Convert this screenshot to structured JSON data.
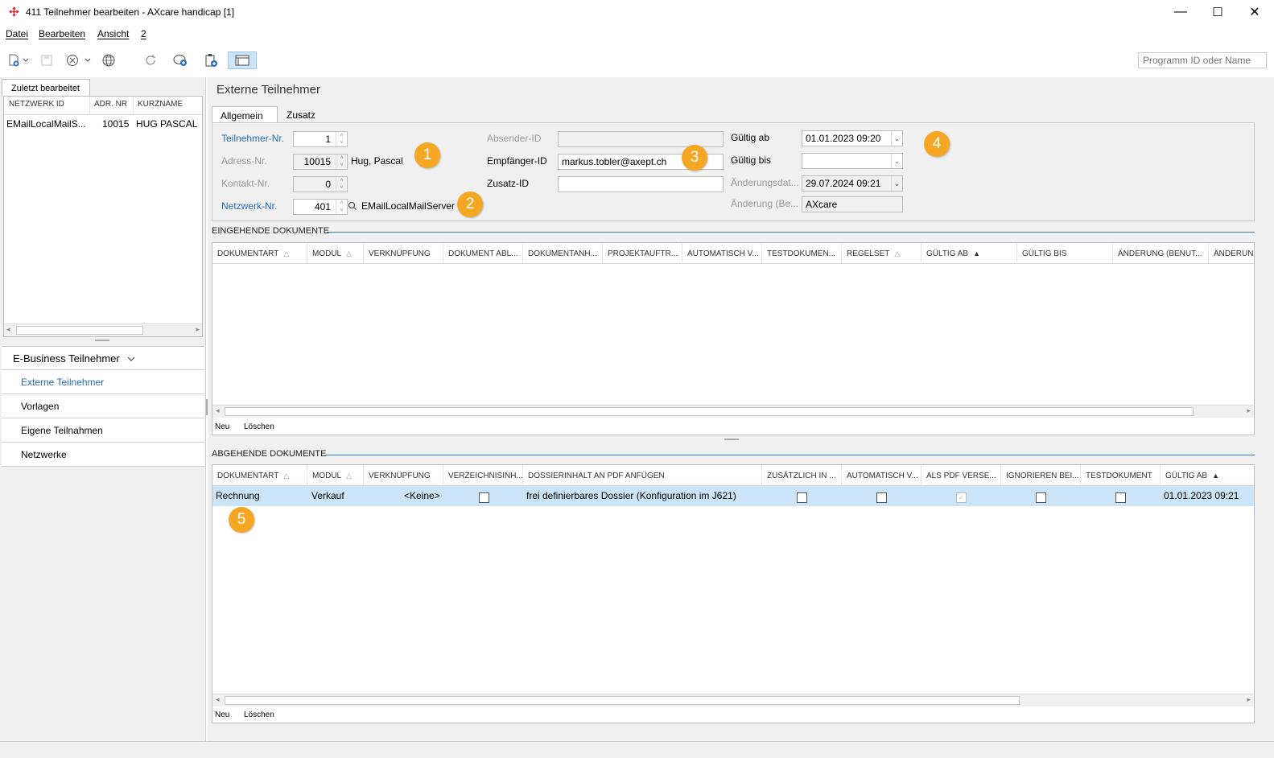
{
  "window": {
    "title": "411 Teilnehmer bearbeiten - AXcare handicap [1]",
    "minimize": "—",
    "maximize": "☐",
    "close": "✕"
  },
  "menu": [
    "Datei",
    "Bearbeiten",
    "Ansicht",
    "2"
  ],
  "toolbar": {
    "search_placeholder": "Programm ID oder Name",
    "icons": [
      "new-icon",
      "save-icon",
      "cancel-icon",
      "globe-icon",
      "refresh-icon",
      "chat-icon",
      "clipboard-icon",
      "window-icon"
    ]
  },
  "recent": {
    "tab": "Zuletzt bearbeitet",
    "columns": [
      "NETZWERK ID",
      "ADR. NR",
      "KURZNAME"
    ],
    "rows": [
      {
        "netzwerk": "EMailLocalMailS...",
        "adr": "10015",
        "kurzname": "HUG PASCAL"
      }
    ]
  },
  "nav": {
    "group": "E-Business Teilnehmer",
    "items": [
      "Externe Teilnehmer",
      "Vorlagen",
      "Eigene Teilnahmen",
      "Netzwerke"
    ]
  },
  "main": {
    "title": "Externe Teilnehmer",
    "tabs": [
      "Allgemein",
      "Zusatz"
    ]
  },
  "form": {
    "teilnehmer_label": "Teilnehmer-Nr.",
    "teilnehmer_value": "1",
    "adress_label": "Adress-Nr.",
    "adress_value": "10015",
    "adress_name": "Hug, Pascal",
    "kontakt_label": "Kontakt-Nr.",
    "kontakt_value": "0",
    "netzwerk_label": "Netzwerk-Nr.",
    "netzwerk_value": "401",
    "netzwerk_name": "EMailLocalMailServer",
    "absender_label": "Absender-ID",
    "absender_value": "",
    "empfaenger_label": "Empfänger-ID",
    "empfaenger_value": "markus.tobler@axept.ch",
    "zusatz_label": "Zusatz-ID",
    "zusatz_value": "",
    "gueltig_ab_label": "Gültig ab",
    "gueltig_ab_value": "01.01.2023 09:20",
    "gueltig_bis_label": "Gültig bis",
    "gueltig_bis_value": "",
    "aenderungsdat_label": "Änderungsdat...",
    "aenderungsdat_value": "29.07.2024 09:21",
    "aenderung_label": "Änderung (Be...",
    "aenderung_value": "AXcare"
  },
  "badges": [
    "1",
    "2",
    "3",
    "4",
    "5"
  ],
  "incoming": {
    "title": "EINGEHENDE DOKUMENTE",
    "columns": [
      "DOKUMENTART",
      "MODUL",
      "VERKNÜPFUNG",
      "DOKUMENT ABL...",
      "DOKUMENTANH...",
      "PROJEKTAUFTR...",
      "AUTOMATISCH V...",
      "TESTDOKUMEN...",
      "REGELSET",
      "GÜLTIG AB",
      "GÜLTIG BIS",
      "ÄNDERUNG (BENUT...",
      "ÄNDERUNG"
    ],
    "footer": [
      "Neu",
      "Löschen"
    ]
  },
  "outgoing": {
    "title": "ABGEHENDE DOKUMENTE",
    "columns": [
      "DOKUMENTART",
      "MODUL",
      "VERKNÜPFUNG",
      "VERZEICHNISINH...",
      "DOSSIERINHALT AN PDF ANFÜGEN",
      "ZUSÄTZLICH IN ...",
      "AUTOMATISCH V...",
      "ALS PDF VERSE...",
      "IGNORIEREN BEI...",
      "TESTDOKUMENT",
      "GÜLTIG AB"
    ],
    "rows": [
      {
        "dokumentart": "Rechnung",
        "modul": "Verkauf",
        "verknuepfung": "<Keine>",
        "dossier": "frei definierbares Dossier (Konfiguration im J621)",
        "gueltig_ab": "01.01.2023 09:21"
      }
    ],
    "footer": [
      "Neu",
      "Löschen"
    ]
  },
  "colors": {
    "accent": "#2a6ebb",
    "badge": "#f5a623",
    "selection": "#cce4f7"
  }
}
